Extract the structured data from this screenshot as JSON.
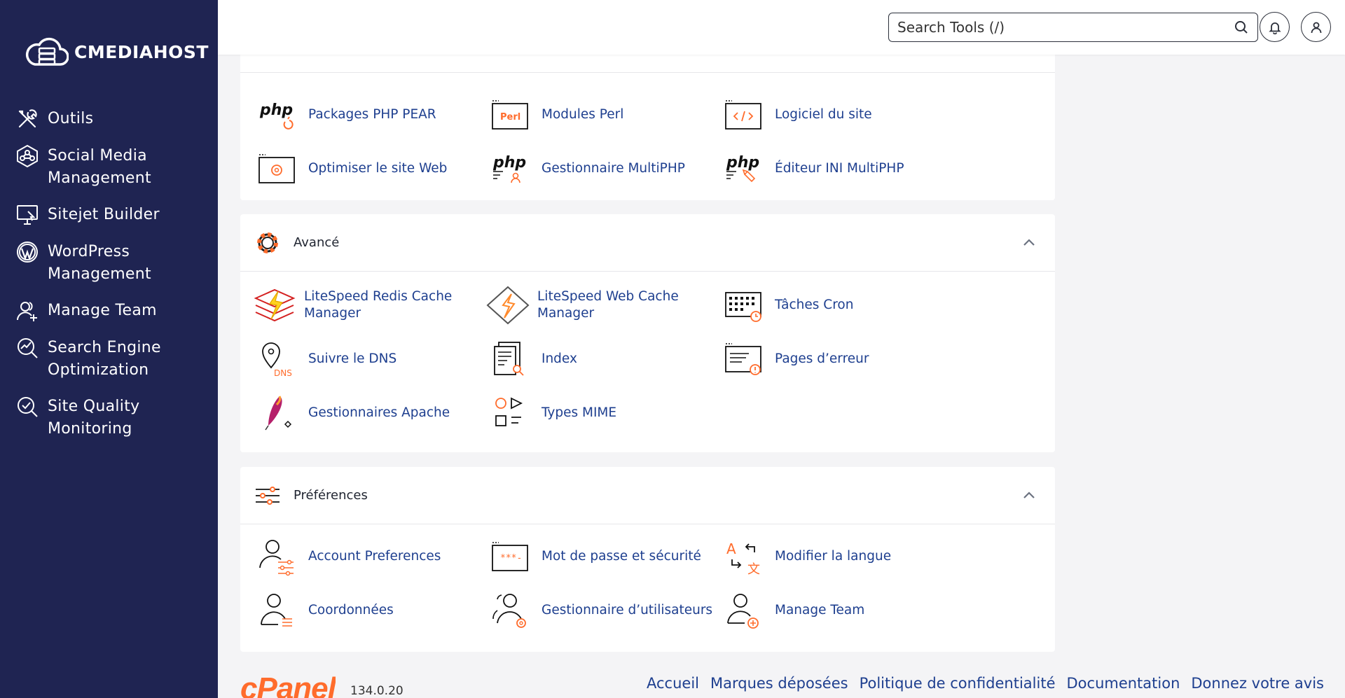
{
  "brand": {
    "name": "CMEDIAHOST"
  },
  "colors": {
    "sidebar": "#1f2452",
    "link": "#1e3f8f",
    "accent": "#ff6c2c"
  },
  "sidebar": {
    "items": [
      {
        "label": "Outils",
        "icon": "tools-icon"
      },
      {
        "label": "Social Media Management",
        "icon": "social-network-icon"
      },
      {
        "label": "Sitejet Builder",
        "icon": "monitor-builder-icon"
      },
      {
        "label": "WordPress Management",
        "icon": "wordpress-icon"
      },
      {
        "label": "Manage Team",
        "icon": "team-icon"
      },
      {
        "label": "Search Engine Optimization",
        "icon": "seo-icon"
      },
      {
        "label": "Site Quality Monitoring",
        "icon": "quality-monitor-icon"
      }
    ]
  },
  "header": {
    "search_placeholder": "Search Tools (/)"
  },
  "top_panel": {
    "tools": [
      {
        "label": "Packages PHP PEAR",
        "icon": "php-pear-icon"
      },
      {
        "label": "Modules Perl",
        "icon": "perl-icon"
      },
      {
        "label": "Logiciel du site",
        "icon": "code-window-icon"
      },
      {
        "label": "Optimiser le site Web",
        "icon": "optimize-icon"
      },
      {
        "label": "Gestionnaire MultiPHP",
        "icon": "multiphp-manager-icon"
      },
      {
        "label": "Éditeur INI MultiPHP",
        "icon": "multiphp-ini-icon"
      }
    ]
  },
  "advanced": {
    "title": "Avancé",
    "tools": [
      {
        "label": "LiteSpeed Redis Cache Manager",
        "icon": "litespeed-redis-icon"
      },
      {
        "label": "LiteSpeed Web Cache Manager",
        "icon": "litespeed-web-icon"
      },
      {
        "label": "Tâches Cron",
        "icon": "cron-icon"
      },
      {
        "label": "Suivre le DNS",
        "icon": "dns-track-icon"
      },
      {
        "label": "Index",
        "icon": "index-icon"
      },
      {
        "label": "Pages d’erreur",
        "icon": "error-pages-icon"
      },
      {
        "label": "Gestionnaires Apache",
        "icon": "apache-feather-icon"
      },
      {
        "label": "Types MIME",
        "icon": "mime-types-icon"
      }
    ]
  },
  "preferences": {
    "title": "Préférences",
    "tools": [
      {
        "label": "Account Preferences",
        "icon": "account-prefs-icon"
      },
      {
        "label": "Mot de passe et sécurité",
        "icon": "password-icon"
      },
      {
        "label": "Modifier la langue",
        "icon": "language-icon"
      },
      {
        "label": "Coordonnées",
        "icon": "contact-icon"
      },
      {
        "label": "Gestionnaire d’utilisateurs",
        "icon": "user-manager-icon"
      },
      {
        "label": "Manage Team",
        "icon": "manage-team-icon"
      }
    ]
  },
  "footer": {
    "brand": "cPanel",
    "version": "134.0.20",
    "links": [
      "Accueil",
      "Marques déposées",
      "Politique de confidentialité",
      "Documentation",
      "Donnez votre avis"
    ]
  }
}
